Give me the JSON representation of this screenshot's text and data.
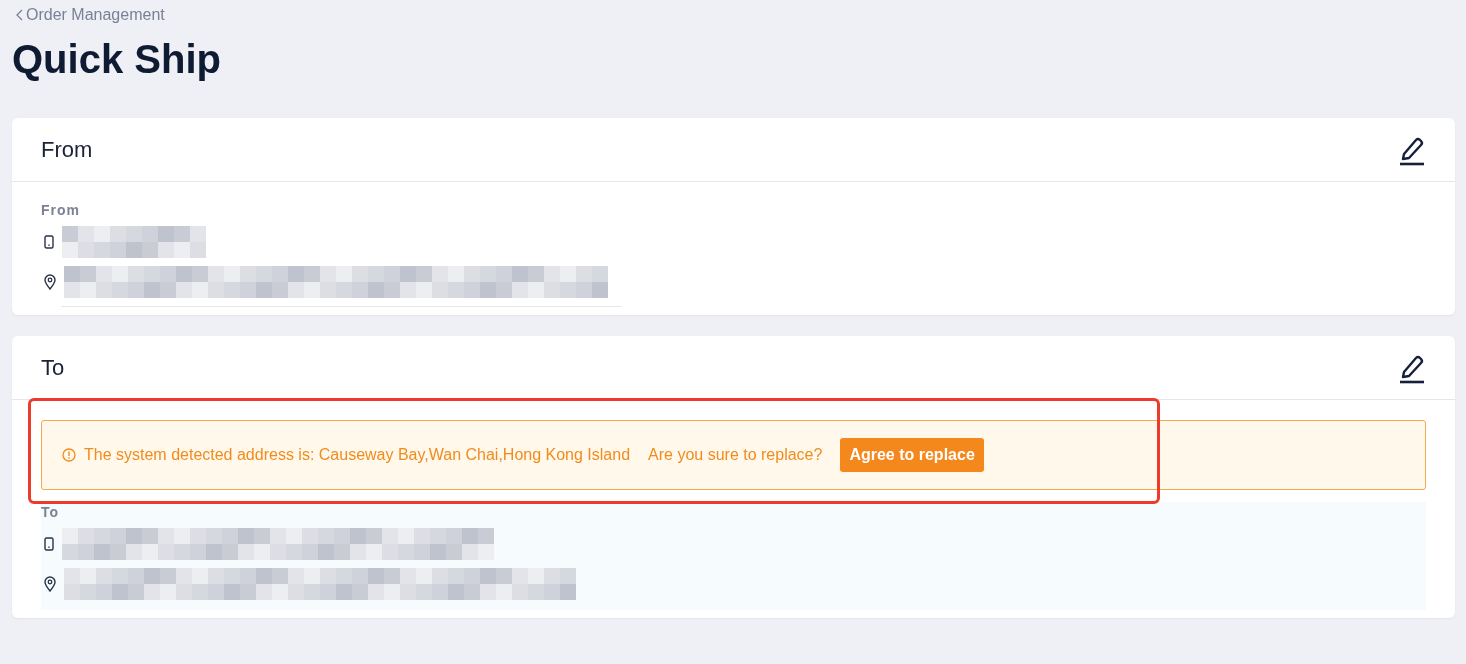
{
  "breadcrumb": {
    "label": "Order Management"
  },
  "title": "Quick Ship",
  "sections": [
    {
      "title": "From",
      "label": "From",
      "highlighted": false
    },
    {
      "title": "To",
      "label": "To",
      "highlighted": true,
      "alert": {
        "message": "The system detected address is: Causeway Bay,Wan Chai,Hong Kong Island",
        "question": "Are you sure to replace?",
        "button": "Agree to replace"
      }
    }
  ]
}
